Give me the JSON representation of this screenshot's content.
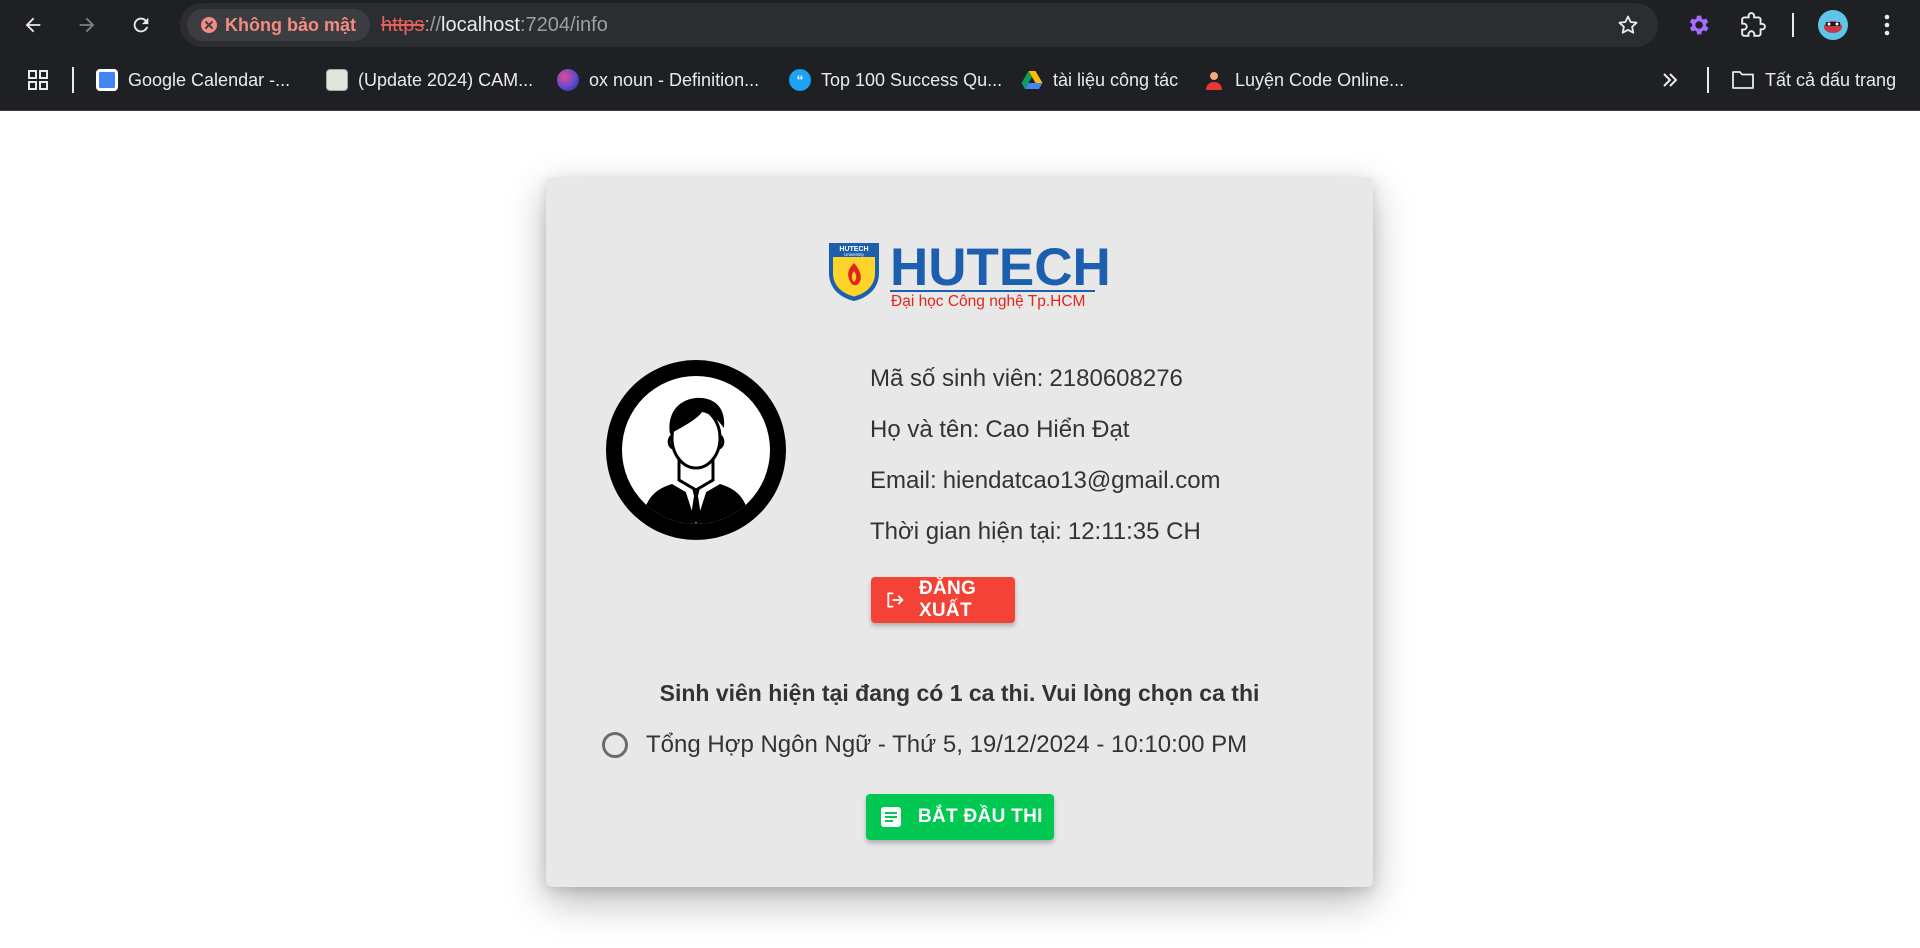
{
  "browser": {
    "security_label": "Không bảo mật",
    "url_scheme": "https",
    "url_sep": "://",
    "url_host": "localhost",
    "url_rest": ":7204/info",
    "bookmarks": [
      {
        "label": "Google Calendar -...",
        "icon": "google-calendar-icon",
        "color": "#4285f4"
      },
      {
        "label": "(Update 2024) CAM...",
        "icon": "site-icon",
        "color": "#cfd8cf"
      },
      {
        "label": "ox noun - Definition...",
        "icon": "oxford-icon",
        "color": "#5b4bd4"
      },
      {
        "label": "Top 100 Success Qu...",
        "icon": "quote-icon",
        "color": "#1da1f2"
      },
      {
        "label": "tài liệu công tác",
        "icon": "google-drive-icon",
        "color": "#fbbc04"
      },
      {
        "label": "Luyện Code Online...",
        "icon": "user-icon",
        "color": "#e53935"
      }
    ],
    "all_bookmarks_label": "Tất cả dấu trang"
  },
  "logo": {
    "brand": "HUTECH",
    "tagline": "Đại học Công nghệ Tp.HCM",
    "shield_text": "HUTECH",
    "shield_subtext": "University"
  },
  "student": {
    "id_label": "Mã số sinh viên:",
    "id_value": "2180608276",
    "name_label": "Họ và tên:",
    "name_value": "Cao Hiển Đạt",
    "email_label": "Email:",
    "email_value": "hiendatcao13@gmail.com",
    "time_label": "Thời gian hiện tại:",
    "time_value": "12:11:35 CH"
  },
  "actions": {
    "logout_label": "ĐĂNG XUẤT",
    "start_label": "BẮT ĐẦU THI"
  },
  "exam": {
    "notice": "Sinh viên hiện tại đang có 1 ca thi. Vui lòng chọn ca thi",
    "options": [
      {
        "label": "Tổng Hợp Ngôn Ngữ - Thứ 5, 19/12/2024 - 10:10:00 PM",
        "selected": false
      }
    ]
  },
  "colors": {
    "logout": "#f44336",
    "start": "#00c853",
    "brand_blue": "#1b5fae",
    "brand_red": "#e0251b"
  }
}
